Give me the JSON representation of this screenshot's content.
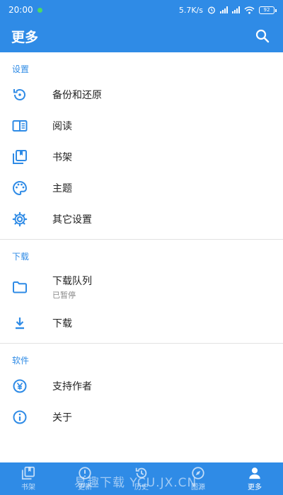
{
  "status_bar": {
    "time": "20:00",
    "speed": "5.7K/s",
    "battery": "92"
  },
  "app_bar": {
    "title": "更多"
  },
  "sections": [
    {
      "header": "设置",
      "items": [
        {
          "label": "备份和还原",
          "icon": "backup-restore-icon"
        },
        {
          "label": "阅读",
          "icon": "book-open-icon"
        },
        {
          "label": "书架",
          "icon": "library-icon"
        },
        {
          "label": "主题",
          "icon": "palette-icon"
        },
        {
          "label": "其它设置",
          "icon": "gear-icon"
        }
      ]
    },
    {
      "header": "下载",
      "items": [
        {
          "label": "下载队列",
          "sub": "已暂停",
          "icon": "folder-icon"
        },
        {
          "label": "下载",
          "icon": "download-icon"
        }
      ]
    },
    {
      "header": "软件",
      "items": [
        {
          "label": "支持作者",
          "icon": "yen-icon"
        },
        {
          "label": "关于",
          "icon": "info-icon"
        }
      ]
    }
  ],
  "bottom_nav": [
    {
      "label": "书架",
      "icon": "library-icon"
    },
    {
      "label": "更新",
      "icon": "update-icon"
    },
    {
      "label": "历史",
      "icon": "history-icon"
    },
    {
      "label": "图源",
      "icon": "compass-icon"
    },
    {
      "label": "更多",
      "icon": "person-icon"
    }
  ],
  "watermark": "易趣下载 YCU.JX.CN",
  "colors": {
    "primary": "#2f8be6",
    "text": "#222222",
    "subtext": "#888888",
    "divider": "#e2e2e2"
  }
}
